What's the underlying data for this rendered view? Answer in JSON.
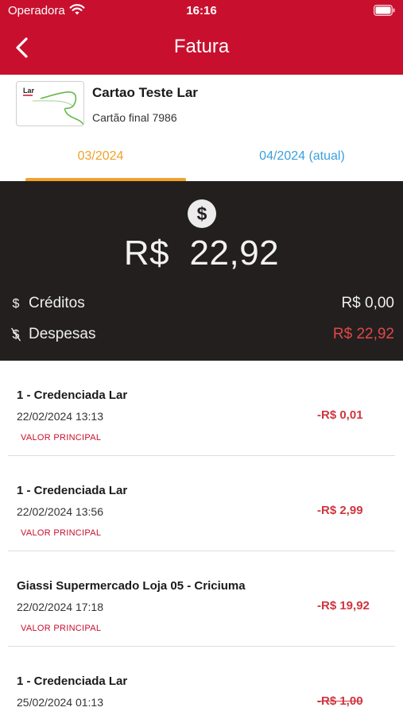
{
  "status_bar": {
    "carrier": "Operadora",
    "time": "16:16"
  },
  "header": {
    "title": "Fatura"
  },
  "card": {
    "brand": "Lar",
    "name": "Cartao Teste Lar",
    "subtitle": "Cartão final 7986"
  },
  "tabs": [
    {
      "label": "03/2024",
      "selected": true
    },
    {
      "label": "04/2024 (atual)",
      "selected": false
    }
  ],
  "summary": {
    "total_currency": "R$",
    "total_value": "22,92",
    "credits_label": "Créditos",
    "credits_value": "R$ 0,00",
    "expenses_label": "Despesas",
    "expenses_value": "R$ 22,92"
  },
  "transactions": [
    {
      "title": "1 - Credenciada Lar",
      "date": "22/02/2024 13:13",
      "tag": "VALOR PRINCIPAL",
      "amount": "-R$ 0,01",
      "struck": false
    },
    {
      "title": "1 - Credenciada Lar",
      "date": "22/02/2024 13:56",
      "tag": "VALOR PRINCIPAL",
      "amount": "-R$ 2,99",
      "struck": false
    },
    {
      "title": "Giassi Supermercado Loja 05 - Criciuma",
      "date": "22/02/2024 17:18",
      "tag": "VALOR PRINCIPAL",
      "amount": "-R$ 19,92",
      "struck": false
    },
    {
      "title": "1 - Credenciada Lar",
      "date": "25/02/2024 01:13",
      "tag": "",
      "amount": "-R$ 1,00",
      "struck": true
    }
  ],
  "colors": {
    "brand_red": "#c8102e",
    "tab_selected": "#f0a22a",
    "tab_unselected": "#3aa0dc",
    "summary_bg": "#231f1f",
    "expense_red": "#e04848"
  }
}
